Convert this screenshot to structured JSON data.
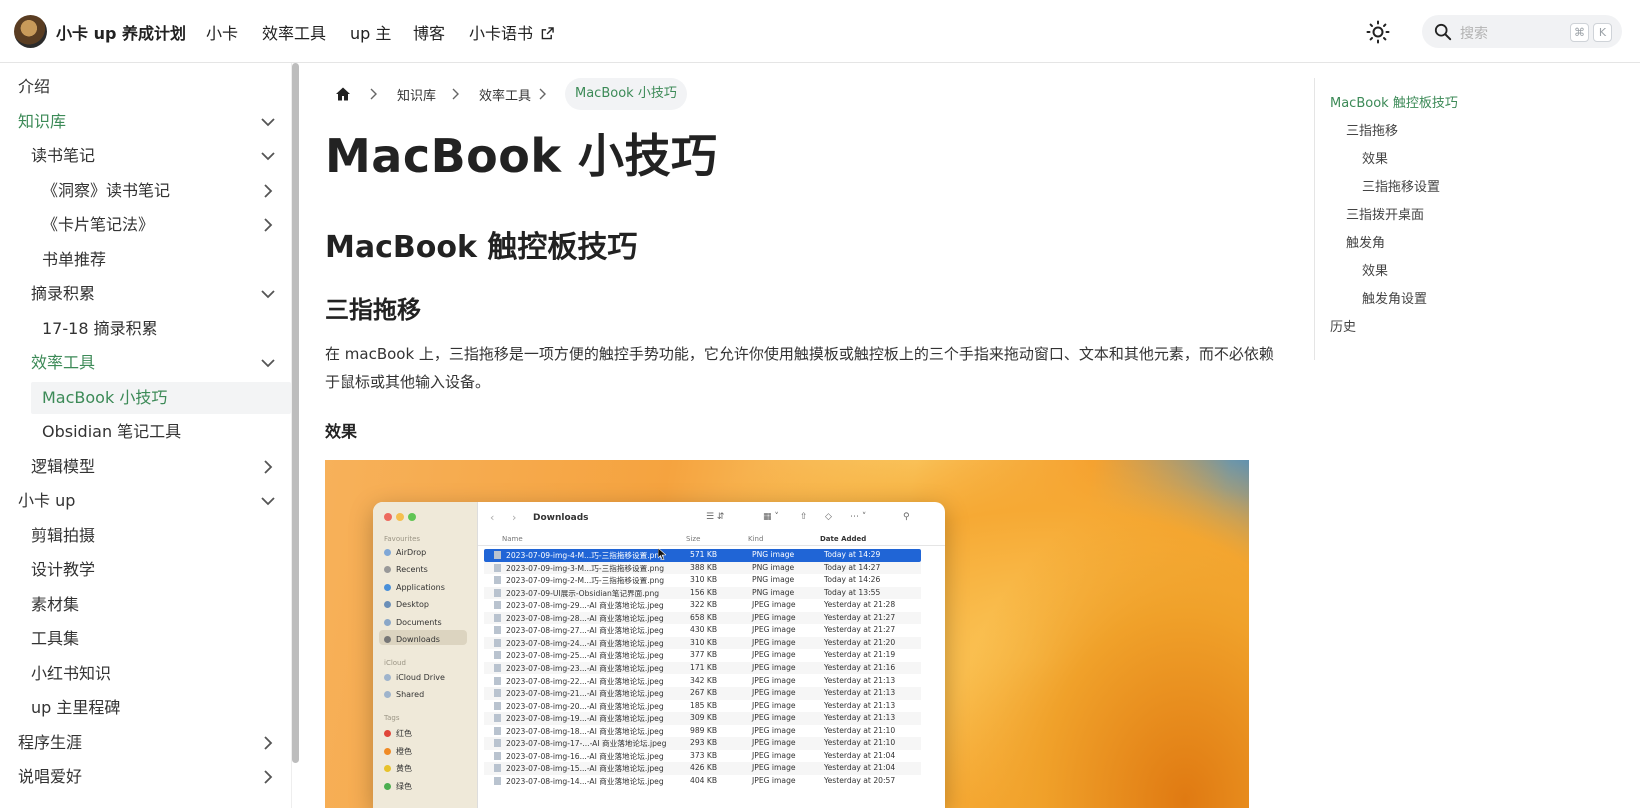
{
  "header": {
    "site_title": "小卡 up 养成计划",
    "nav": [
      "小卡",
      "效率工具",
      "up 主",
      "博客",
      "小卡语书"
    ],
    "search_placeholder": "搜索",
    "shortcut_keys": [
      "⌘",
      "K"
    ]
  },
  "sidebar": {
    "items": [
      {
        "label": "介绍"
      },
      {
        "label": "知识库"
      },
      {
        "label": "读书笔记"
      },
      {
        "label": "《洞察》读书笔记"
      },
      {
        "label": "《卡片笔记法》"
      },
      {
        "label": "书单推荐"
      },
      {
        "label": "摘录积累"
      },
      {
        "label": "17-18 摘录积累"
      },
      {
        "label": "效率工具"
      },
      {
        "label": "MacBook 小技巧"
      },
      {
        "label": "Obsidian 笔记工具"
      },
      {
        "label": "逻辑模型"
      },
      {
        "label": "小卡 up"
      },
      {
        "label": "剪辑拍摄"
      },
      {
        "label": "设计教学"
      },
      {
        "label": "素材集"
      },
      {
        "label": "工具集"
      },
      {
        "label": "小红书知识"
      },
      {
        "label": "up 主里程碑"
      },
      {
        "label": "程序生涯"
      },
      {
        "label": "说唱爱好"
      }
    ]
  },
  "breadcrumb": [
    "知识库",
    "效率工具",
    "MacBook 小技巧"
  ],
  "article": {
    "title": "MacBook 小技巧",
    "h2": "MacBook 触控板技巧",
    "h3": "三指拖移",
    "paragraph": "在 macBook 上，三指拖移是一项方便的触控手势功能，它允许你使用触摸板或触控板上的三个手指来拖动窗口、文本和其他元素，而不必依赖于鼠标或其他输入设备。",
    "h4": "效果"
  },
  "finder": {
    "title": "Downloads",
    "sidebar_sections": [
      "Favourites",
      "iCloud",
      "Tags"
    ],
    "favourites": [
      "AirDrop",
      "Recents",
      "Applications",
      "Desktop",
      "Documents",
      "Downloads"
    ],
    "icloud": [
      "iCloud Drive",
      "Shared"
    ],
    "tags": [
      "红色",
      "橙色",
      "黄色",
      "绿色"
    ],
    "tag_colors": [
      "#e0463a",
      "#f08a24",
      "#e8c22b",
      "#4caf50"
    ],
    "columns": [
      "Name",
      "Size",
      "Kind",
      "Date Added"
    ],
    "rows": [
      [
        "2023-07-09-img-4-M...巧-三指拖移设置.png",
        "571 KB",
        "PNG image",
        "Today at 14:29"
      ],
      [
        "2023-07-09-img-3-M...巧-三指拖移设置.png",
        "388 KB",
        "PNG image",
        "Today at 14:27"
      ],
      [
        "2023-07-09-img-2-M...巧-三指拖移设置.png",
        "310 KB",
        "PNG image",
        "Today at 14:26"
      ],
      [
        "2023-07-09-UI展示-Obsidian笔记界面.png",
        "156 KB",
        "PNG image",
        "Today at 13:55"
      ],
      [
        "2023-07-08-img-29...-AI 商业落地论坛.jpeg",
        "322 KB",
        "JPEG image",
        "Yesterday at 21:28"
      ],
      [
        "2023-07-08-img-28...-AI 商业落地论坛.jpeg",
        "658 KB",
        "JPEG image",
        "Yesterday at 21:27"
      ],
      [
        "2023-07-08-img-27...-AI 商业落地论坛.jpeg",
        "430 KB",
        "JPEG image",
        "Yesterday at 21:27"
      ],
      [
        "2023-07-08-img-24...-AI 商业落地论坛.jpeg",
        "310 KB",
        "JPEG image",
        "Yesterday at 21:20"
      ],
      [
        "2023-07-08-img-25...-AI 商业落地论坛.jpeg",
        "377 KB",
        "JPEG image",
        "Yesterday at 21:19"
      ],
      [
        "2023-07-08-img-23...-AI 商业落地论坛.jpeg",
        "171 KB",
        "JPEG image",
        "Yesterday at 21:16"
      ],
      [
        "2023-07-08-img-22...-AI 商业落地论坛.jpeg",
        "342 KB",
        "JPEG image",
        "Yesterday at 21:13"
      ],
      [
        "2023-07-08-img-21...-AI 商业落地论坛.jpeg",
        "267 KB",
        "JPEG image",
        "Yesterday at 21:13"
      ],
      [
        "2023-07-08-img-20...-AI 商业落地论坛.jpeg",
        "185 KB",
        "JPEG image",
        "Yesterday at 21:13"
      ],
      [
        "2023-07-08-img-19...-AI 商业落地论坛.jpeg",
        "309 KB",
        "JPEG image",
        "Yesterday at 21:13"
      ],
      [
        "2023-07-08-img-18...-AI 商业落地论坛.jpeg",
        "989 KB",
        "JPEG image",
        "Yesterday at 21:10"
      ],
      [
        "2023-07-08-img-17-...-AI 商业落地论坛.jpeg",
        "293 KB",
        "JPEG image",
        "Yesterday at 21:10"
      ],
      [
        "2023-07-08-img-16...-AI 商业落地论坛.jpeg",
        "373 KB",
        "JPEG image",
        "Yesterday at 21:04"
      ],
      [
        "2023-07-08-img-15...-AI 商业落地论坛.jpeg",
        "426 KB",
        "JPEG image",
        "Yesterday at 21:04"
      ],
      [
        "2023-07-08-img-14...-AI 商业落地论坛.jpeg",
        "404 KB",
        "JPEG image",
        "Yesterday at 20:57"
      ]
    ]
  },
  "toc": {
    "items": [
      {
        "label": "MacBook 触控板技巧"
      },
      {
        "label": "三指拖移"
      },
      {
        "label": "效果"
      },
      {
        "label": "三指拖移设置"
      },
      {
        "label": "三指拨开桌面"
      },
      {
        "label": "触发角"
      },
      {
        "label": "效果"
      },
      {
        "label": "触发角设置"
      },
      {
        "label": "历史"
      }
    ]
  },
  "colors": {
    "accent": "#3c8a57",
    "finder_selection": "#2065d6"
  }
}
